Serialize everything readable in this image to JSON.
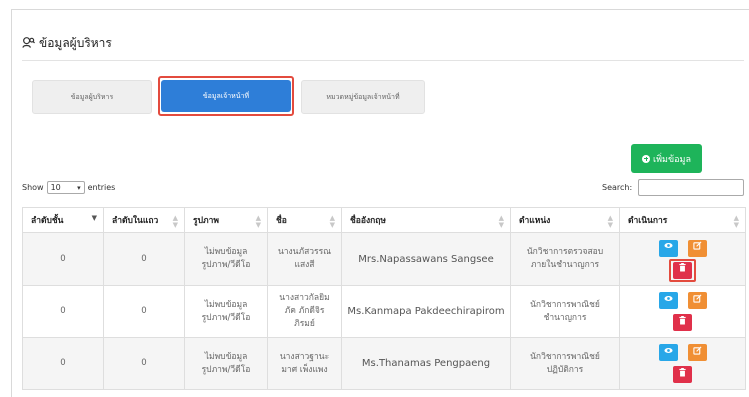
{
  "page": {
    "title": "ข้อมูลผู้บริหาร"
  },
  "tabs": [
    {
      "label": "ข้อมูลผู้บริหาร",
      "active": false
    },
    {
      "label": "ข้อมูลเจ้าหน้าที่",
      "active": true
    },
    {
      "label": "หมวดหมู่ข้อมูลเจ้าหน้าที่",
      "active": false
    }
  ],
  "toolbar": {
    "add_label": "เพิ่มข้อมูล",
    "show_label": "Show",
    "entries_value": "10",
    "entries_label": "entries",
    "search_label": "Search:",
    "search_value": ""
  },
  "table": {
    "columns": [
      "ลำดับชั้น",
      "ลำดับในแถว",
      "รูปภาพ",
      "ชื่อ",
      "ชื่ออังกฤษ",
      "ตำแหน่ง",
      "ดำเนินการ"
    ],
    "rows": [
      {
        "level": "0",
        "order": "0",
        "image": [
          "ไม่พบข้อมูล",
          "รูปภาพ/วีดีโอ"
        ],
        "name": [
          "นางนภัสวรรณ",
          "แสงสี"
        ],
        "name_en": "Mrs.Napassawans Sangsee",
        "position": [
          "นักวิชาการตรวจสอบ",
          "ภายในชำนาญการ"
        ]
      },
      {
        "level": "0",
        "order": "0",
        "image": [
          "ไม่พบข้อมูล",
          "รูปภาพ/วีดีโอ"
        ],
        "name": [
          "นางสาวกัลยิม",
          "ภัค ภักดีจิร",
          "ภิรมย์"
        ],
        "name_en": "Ms.Kanmapa Pakdeechirapirom",
        "position": [
          "นักวิชาการพาณิชย์",
          "ชำนาญการ"
        ]
      },
      {
        "level": "0",
        "order": "0",
        "image": [
          "ไม่พบข้อมูล",
          "รูปภาพ/วีดีโอ"
        ],
        "name": [
          "นางสาวฐานะ",
          "มาศ เพ็งแพง"
        ],
        "name_en": "Ms.Thanamas Pengpaeng",
        "position": [
          "นักวิชาการพาณิชย์",
          "ปฏิบัติการ"
        ]
      }
    ]
  },
  "icons": {
    "header": "people-search-icon",
    "add": "plus-circle-icon",
    "view": "eye-icon",
    "edit": "edit-icon",
    "delete": "trash-icon"
  },
  "colors": {
    "primary": "#2e7ed8",
    "success": "#1eb45a",
    "info": "#28a7e8",
    "warning": "#f08f34",
    "danger": "#e0304a",
    "highlight": "#e34b3e"
  }
}
